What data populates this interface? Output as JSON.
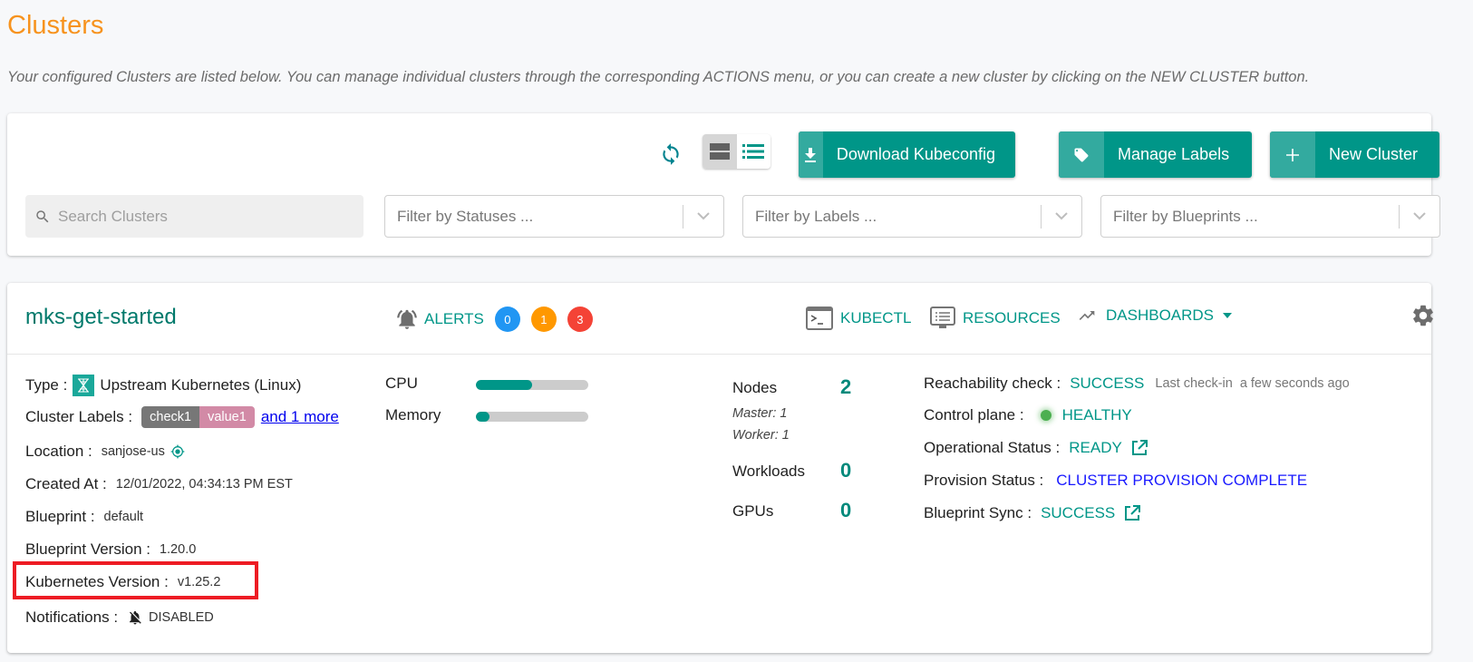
{
  "page": {
    "title": "Clusters",
    "description": "Your configured Clusters are listed below. You can manage individual clusters through the corresponding ACTIONS menu, or you can create a new cluster by clicking on the NEW CLUSTER button."
  },
  "toolbar": {
    "refresh_icon": "refresh-icon",
    "view_toggle": {
      "card_icon": "card-view-icon",
      "list_icon": "list-view-icon",
      "active": "card"
    },
    "buttons": {
      "download": {
        "label": "Download Kubeconfig",
        "icon": "download-icon"
      },
      "labels": {
        "label": "Manage Labels",
        "icon": "tag-icon"
      },
      "new_cluster": {
        "label": "New Cluster",
        "icon": "plus-icon"
      }
    },
    "search": {
      "placeholder": "Search Clusters",
      "value": ""
    },
    "filters": {
      "statuses": "Filter by Statuses ...",
      "labels": "Filter by Labels ...",
      "blueprints": "Filter by Blueprints ..."
    }
  },
  "cluster": {
    "name": "mks-get-started",
    "alerts": {
      "label": "ALERTS",
      "counts": [
        "0",
        "1",
        "3"
      ],
      "colors": [
        "#2196f3",
        "#ff9800",
        "#f44336"
      ]
    },
    "actions": {
      "kubectl": "KUBECTL",
      "resources": "RESOURCES",
      "dashboards": "DASHBOARDS"
    },
    "details": {
      "type_label": "Type :",
      "type_value": "Upstream Kubernetes (Linux)",
      "labels_label": "Cluster Labels :",
      "label_key": "check1",
      "label_value": "value1",
      "labels_more": "and 1 more",
      "location_label": "Location :",
      "location_value": "sanjose-us",
      "created_label": "Created At :",
      "created_value": "12/01/2022, 04:34:13 PM EST",
      "blueprint_label": "Blueprint :",
      "blueprint_value": "default",
      "bp_version_label": "Blueprint Version :",
      "bp_version_value": "1.20.0",
      "k8s_version_label": "Kubernetes Version :",
      "k8s_version_value": "v1.25.2",
      "notifications_label": "Notifications :",
      "notifications_value": "DISABLED"
    },
    "usage": {
      "cpu_label": "CPU",
      "cpu_percent": 50,
      "memory_label": "Memory",
      "memory_percent": 12
    },
    "stats": {
      "nodes_label": "Nodes",
      "nodes_value": "2",
      "master": "Master: 1",
      "worker": "Worker: 1",
      "workloads_label": "Workloads",
      "workloads_value": "0",
      "gpus_label": "GPUs",
      "gpus_value": "0"
    },
    "status": {
      "reachability_label": "Reachability check :",
      "reachability_value": "SUCCESS",
      "last_checkin_label": "Last check-in",
      "last_checkin_value": "a few seconds ago",
      "control_plane_label": "Control plane :",
      "control_plane_value": "HEALTHY",
      "operational_label": "Operational Status :",
      "operational_value": "READY",
      "provision_label": "Provision Status :",
      "provision_value": "CLUSTER PROVISION COMPLETE",
      "bp_sync_label": "Blueprint Sync :",
      "bp_sync_value": "SUCCESS"
    }
  },
  "colors": {
    "accent": "#009688",
    "title": "#f7931e",
    "highlight": "#ed1c24"
  }
}
